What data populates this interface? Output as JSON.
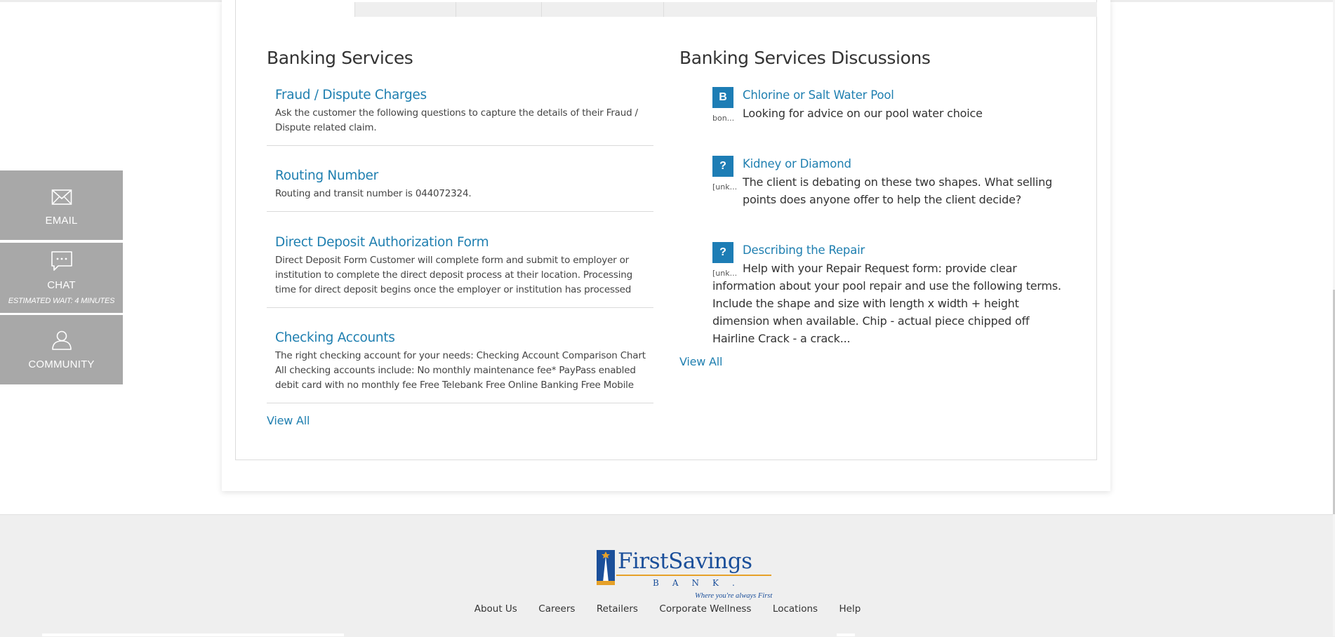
{
  "left_section": {
    "title": "Banking Services",
    "articles": [
      {
        "title": "Fraud / Dispute Charges",
        "desc": "Ask the customer the following questions to capture the details of their Fraud / Dispute related claim."
      },
      {
        "title": "Routing Number",
        "desc": "Routing and transit number is 044072324."
      },
      {
        "title": "Direct Deposit Authorization Form",
        "desc": "Direct Deposit Form Customer will complete form and submit to employer or institution to complete the direct deposit process at their location. Processing time for direct deposit begins once the employer or institution has processed their portion of..."
      },
      {
        "title": "Checking Accounts",
        "desc": "The right checking account for your needs: Checking Account Comparison Chart All checking accounts include: No monthly maintenance fee* PayPass enabled debit card with no monthly fee Free Telebank Free Online Banking Free Mobile Banking**..."
      }
    ],
    "view_all": "View All"
  },
  "right_section": {
    "title": "Banking Services Discussions",
    "discussions": [
      {
        "badge": "B",
        "author": "bon...",
        "title": "Chlorine or Salt Water Pool",
        "body": "Looking for advice on our pool water choice"
      },
      {
        "badge": "?",
        "author": "[unk...",
        "title": "Kidney or Diamond",
        "body": "The client is debating on these two shapes.  What selling points does anyone offer to help the client decide?"
      },
      {
        "badge": "?",
        "author": "[unk...",
        "title": "Describing the Repair",
        "body": "Help with your Repair Request form: provide clear information about your pool repair and use the following terms.  Include the shape and size with length x width + height dimension when available. Chip - actual piece chipped off Hairline Crack - a crack..."
      }
    ],
    "view_all": "View All"
  },
  "contact": {
    "email_label": "EMAIL",
    "chat_label": "CHAT",
    "chat_wait": "ESTIMATED WAIT: 4 MINUTES",
    "community_label": "COMMUNITY"
  },
  "footer": {
    "logo_name": "FirstSavings",
    "logo_sub": "BANK.",
    "logo_tagline": "Where you're always First",
    "links": [
      "About Us",
      "Careers",
      "Retailers",
      "Corporate Wellness",
      "Locations",
      "Help"
    ]
  },
  "colors": {
    "link": "#1f7fb0",
    "badge": "#1d7db5",
    "contact_bg": "#a8a8a8",
    "logo_blue": "#1b4f9a",
    "logo_gold": "#e6a129"
  }
}
